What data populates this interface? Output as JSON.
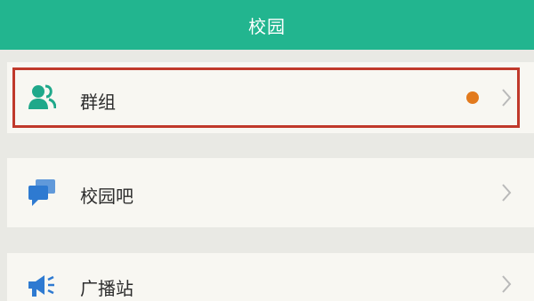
{
  "header": {
    "title": "校园"
  },
  "items": [
    {
      "label": "群组",
      "icon": "group-icon",
      "has_badge": true,
      "highlighted": true
    },
    {
      "label": "校园吧",
      "icon": "chat-bubbles-icon",
      "has_badge": false
    },
    {
      "label": "广播站",
      "icon": "megaphone-icon",
      "has_badge": false
    }
  ],
  "colors": {
    "header_bg": "#22b58f",
    "icon_teal": "#1fa88a",
    "icon_blue": "#2e7ad1",
    "badge": "#e27a1d",
    "highlight_border": "#c0392b"
  }
}
